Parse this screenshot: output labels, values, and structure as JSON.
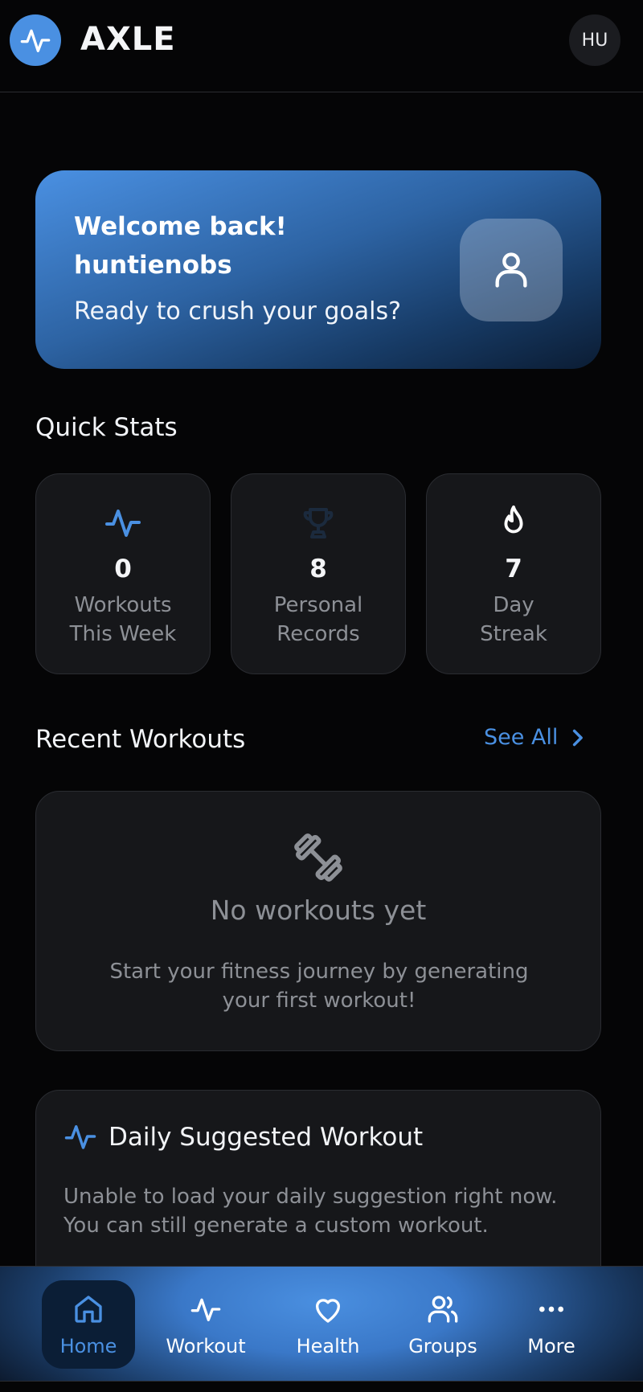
{
  "app": {
    "title": "AXLE",
    "avatar_initials": "HU",
    "accent_color": "#4a90e2"
  },
  "welcome": {
    "greeting": "Welcome back!",
    "username": "huntienobs",
    "subtitle": "Ready to crush your goals?",
    "icon": "user-icon"
  },
  "quick_stats": {
    "title": "Quick Stats",
    "items": [
      {
        "icon": "activity-icon",
        "value": "0",
        "label_line1": "Workouts",
        "label_line2": "This Week"
      },
      {
        "icon": "trophy-icon",
        "value": "8",
        "label_line1": "Personal",
        "label_line2": "Records"
      },
      {
        "icon": "flame-icon",
        "value": "7",
        "label_line1": "Day",
        "label_line2": "Streak"
      }
    ]
  },
  "recent_workouts": {
    "title": "Recent Workouts",
    "see_all": "See All",
    "empty_title": "No workouts yet",
    "empty_desc": "Start your fitness journey by generating your first workout!"
  },
  "daily_suggested": {
    "title": "Daily Suggested Workout",
    "desc": "Unable to load your daily suggestion right now. You can still generate a custom workout."
  },
  "bottom_nav": {
    "items": [
      {
        "label": "Home",
        "icon": "home-icon",
        "active": true
      },
      {
        "label": "Workout",
        "icon": "activity-icon"
      },
      {
        "label": "Health",
        "icon": "heart-icon"
      },
      {
        "label": "Groups",
        "icon": "users-icon"
      },
      {
        "label": "More",
        "icon": "more-icon"
      }
    ]
  }
}
